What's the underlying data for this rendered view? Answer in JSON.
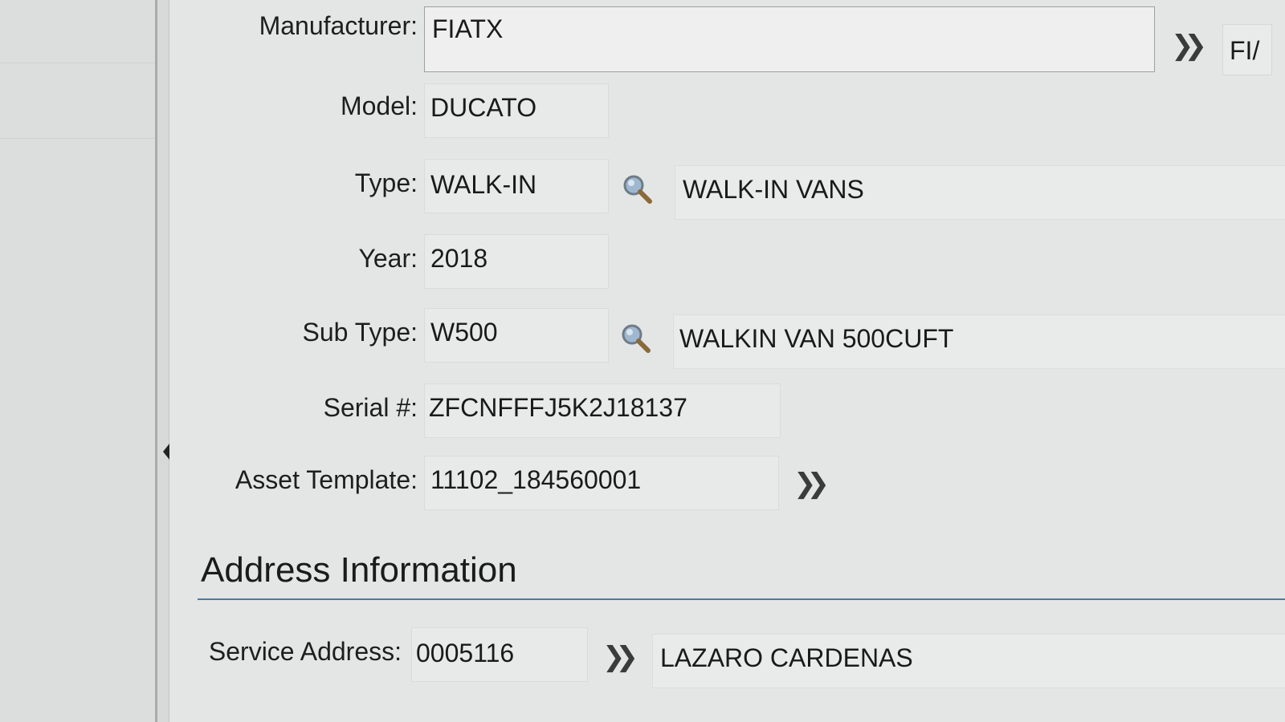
{
  "fields": {
    "manufacturer": {
      "label": "Manufacturer:",
      "value": "FIATX",
      "overflow_text": "FI/"
    },
    "model": {
      "label": "Model:",
      "value": "DUCATO"
    },
    "type": {
      "label": "Type:",
      "value": "WALK-IN",
      "description": "WALK-IN VANS"
    },
    "year": {
      "label": "Year:",
      "value": "2018"
    },
    "sub_type": {
      "label": "Sub Type:",
      "value": "W500",
      "description": "WALKIN VAN 500CUFT"
    },
    "serial": {
      "label": "Serial #:",
      "value": "ZFCNFFFJ5K2J18137"
    },
    "asset_template": {
      "label": "Asset Template:",
      "value": "11102_184560001"
    }
  },
  "address_section": {
    "title": "Address Information",
    "service_address": {
      "label": "Service Address:",
      "value": "0005116",
      "description": "LAZARO CARDENAS"
    }
  },
  "icons": {
    "navigate": "double-chevron-right-icon",
    "lookup": "magnifier-icon"
  },
  "colors": {
    "section_rule": "#4a79a8",
    "background": "#e4e6e5"
  }
}
